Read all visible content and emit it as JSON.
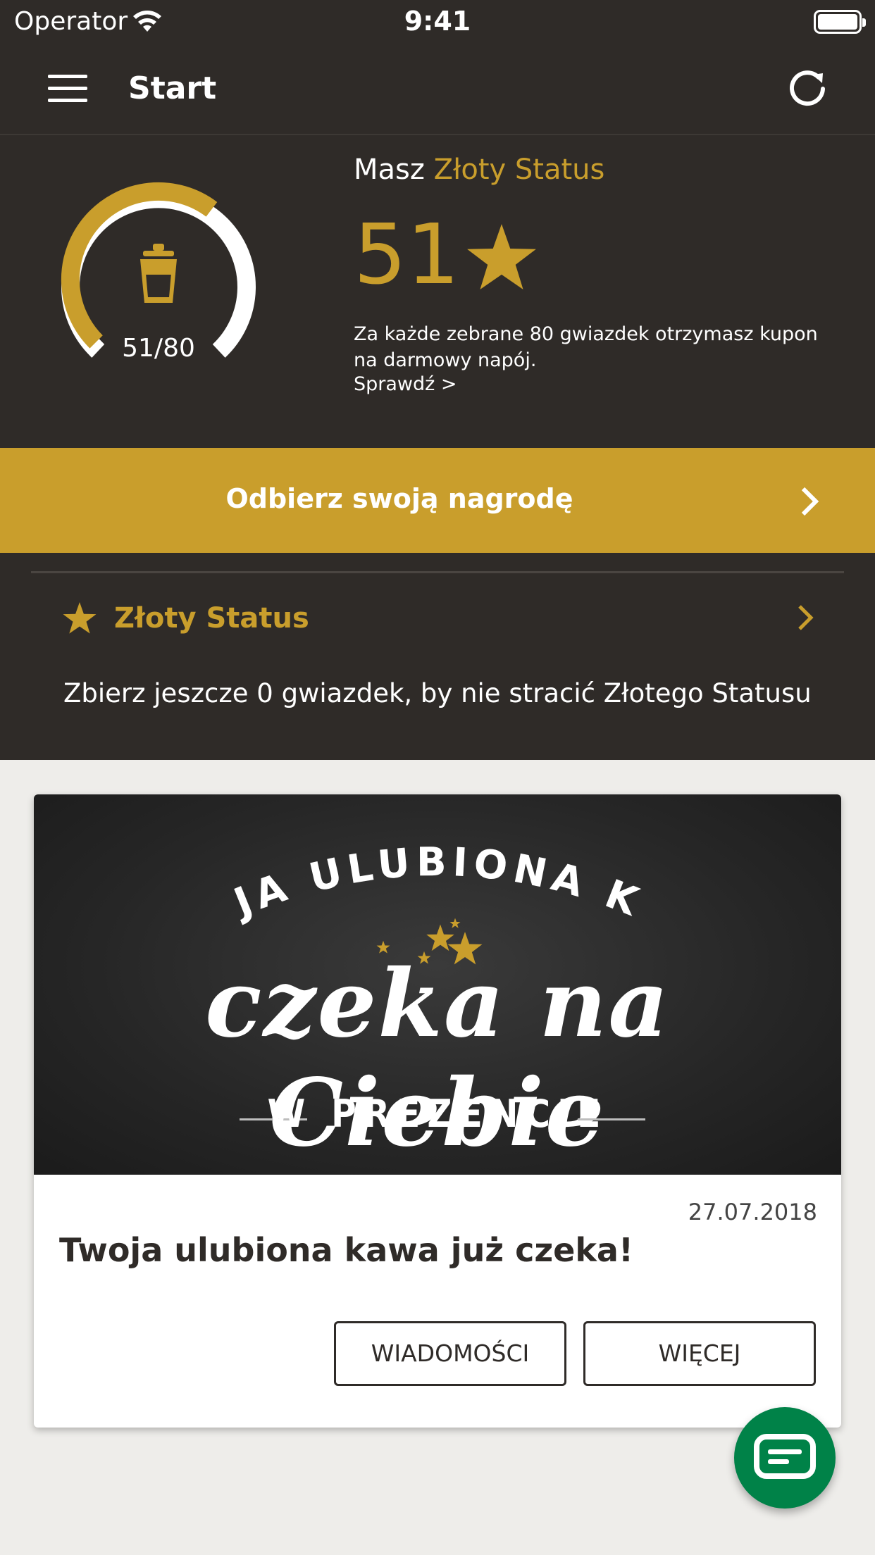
{
  "status_bar": {
    "carrier": "Operator",
    "time": "9:41"
  },
  "nav": {
    "title": "Start",
    "menu_icon": "hamburger-icon",
    "refresh_icon": "refresh-icon"
  },
  "status": {
    "progress_current": 51,
    "progress_target": 80,
    "progress_label": "51/80",
    "prefix": "Masz ",
    "tier": "Złoty Status",
    "stars": "51",
    "info": "Za każde zebrane 80 gwiazdek otrzymasz kupon na darmowy napój.",
    "check_link": "Sprawdź >",
    "icon": "cup-icon"
  },
  "reward": {
    "label": "Odbierz swoją nagrodę"
  },
  "gold_status": {
    "title": "Złoty Status",
    "description": "Zbierz jeszcze 0 gwiazdek, by nie stracić Złotego Statusu"
  },
  "card": {
    "banner_top": "TWOJA ULUBIONA KAWA",
    "banner_script": "czeka na Ciebie",
    "banner_bottom": "W PREZENCIE",
    "date": "27.07.2018",
    "title": "Twoja ulubiona kawa już czeka!",
    "button_messages": "WIADOMOŚCI",
    "button_more": "WIĘCEJ"
  },
  "fab": {
    "icon": "card-icon"
  },
  "colors": {
    "dark": "#2f2b28",
    "gold": "#c99e2c",
    "green": "#008248",
    "background": "#eeedea"
  }
}
